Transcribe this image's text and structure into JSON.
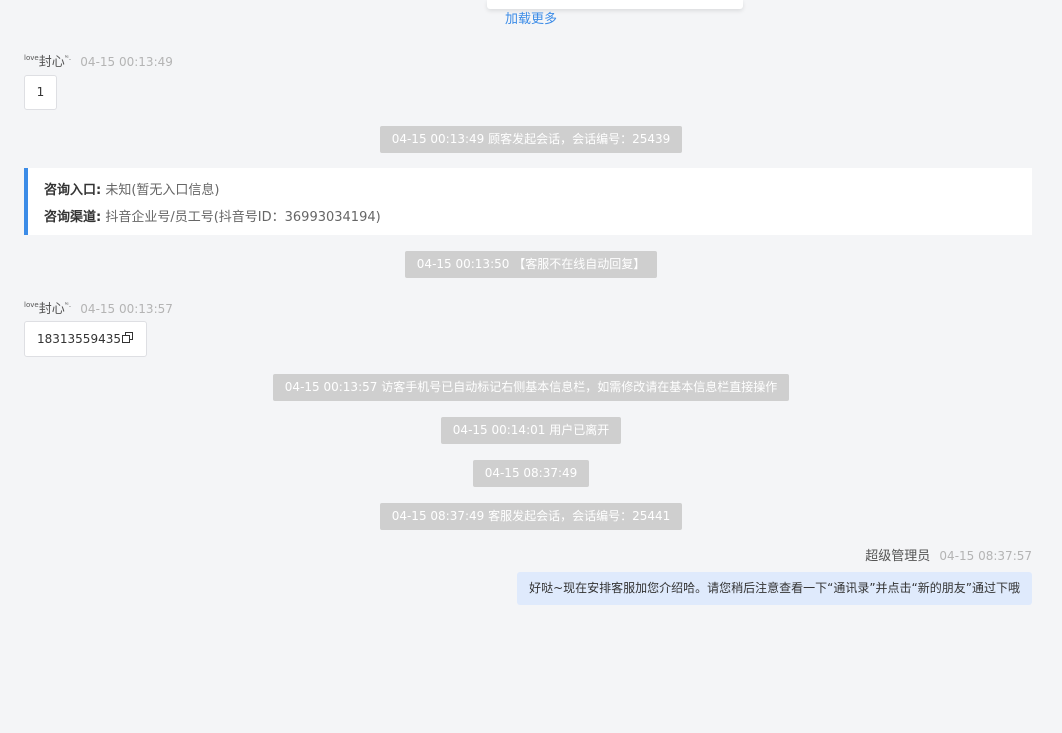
{
  "top_link": {
    "load_more": "加载更多"
  },
  "messages": [
    {
      "sender_prefix": "love",
      "sender_name": "封心",
      "sender_suffix": "ᴵᵉ.",
      "time": "04-15 00:13:49",
      "text": "1"
    },
    {
      "sender_prefix": "love",
      "sender_name": "封心",
      "sender_suffix": "ᴵᵉ.",
      "time": "04-15 00:13:57",
      "text": "18313559435"
    }
  ],
  "system": [
    "04-15 00:13:49 顾客发起会话，会话编号：25439",
    "04-15 00:13:50 【客服不在线自动回复】",
    "04-15 00:13:57 访客手机号已自动标记右侧基本信息栏，如需修改请在基本信息栏直接操作",
    "04-15 00:14:01 用户已离开",
    "04-15 08:37:49",
    "04-15 08:37:49 客服发起会话，会话编号：25441"
  ],
  "consult": {
    "entry_label": "咨询入口:",
    "entry_value": "未知(暂无入口信息)",
    "channel_label": "咨询渠道:",
    "channel_value": "抖音企业号/员工号(抖音号ID：36993034194)"
  },
  "agent_message": {
    "sender": "超级管理员",
    "time": "04-15 08:37:57",
    "text": "好哒~现在安排客服加您介绍哈。请您稍后注意查看一下“通讯录”并点击“新的朋友”通过下哦"
  },
  "colors": {
    "background": "#f4f5f7",
    "link": "#3c8ce7",
    "system_pill": "#cfcfcf",
    "agent_bubble": "#dfeafc"
  },
  "icons": {
    "copy": "copy-icon"
  }
}
